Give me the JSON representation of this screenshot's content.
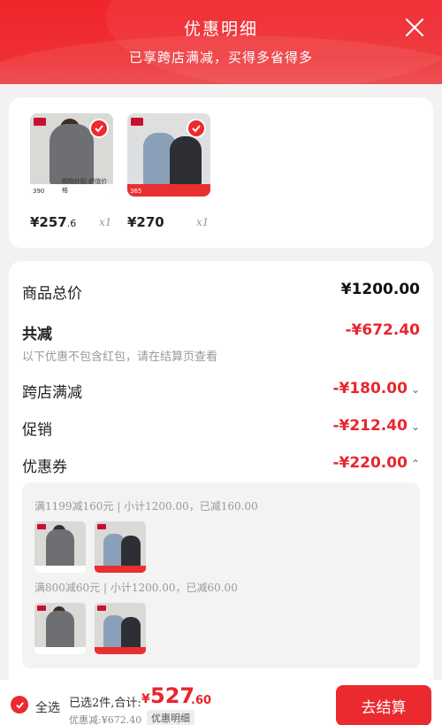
{
  "header": {
    "title": "优惠明细",
    "subtitle": "已享跨店满减，买得多省得多",
    "close_icon": "close-icon"
  },
  "products": [
    {
      "price_int": "¥257",
      "price_dec": ".6",
      "qty": "x1",
      "thumb_label": "390",
      "thumb_note": "购物补贴·超值价格"
    },
    {
      "price_int": "¥270",
      "price_dec": "",
      "qty": "x1",
      "thumb_label": "365",
      "thumb_note": ""
    }
  ],
  "summary": {
    "total_label": "商品总价",
    "total_value": "¥1200.00",
    "reduce_label": "共减",
    "reduce_value": "-¥672.40",
    "note": "以下优惠不包含红包，请在结算页查看",
    "lines": [
      {
        "label": "跨店满减",
        "value": "-¥180.00",
        "caret": "⌄"
      },
      {
        "label": "促销",
        "value": "-¥212.40",
        "caret": "⌄"
      },
      {
        "label": "优惠券",
        "value": "-¥220.00",
        "caret": "⌃"
      }
    ]
  },
  "coupons": [
    {
      "text": "满1199减160元 | 小计1200.00，已减160.00"
    },
    {
      "text": "满800减60元 | 小计1200.00，已减60.00"
    }
  ],
  "bottom": {
    "select_all": "全选",
    "selected_text": "已选2件,合计:",
    "total_symbol": "¥",
    "total_int": "527",
    "total_dec": ".60",
    "discount_text": "优惠减:¥672.40",
    "detail_tag": "优惠明细",
    "checkout": "去结算"
  },
  "colors": {
    "accent": "#ea2a2f",
    "discount_red": "#e8262c"
  }
}
